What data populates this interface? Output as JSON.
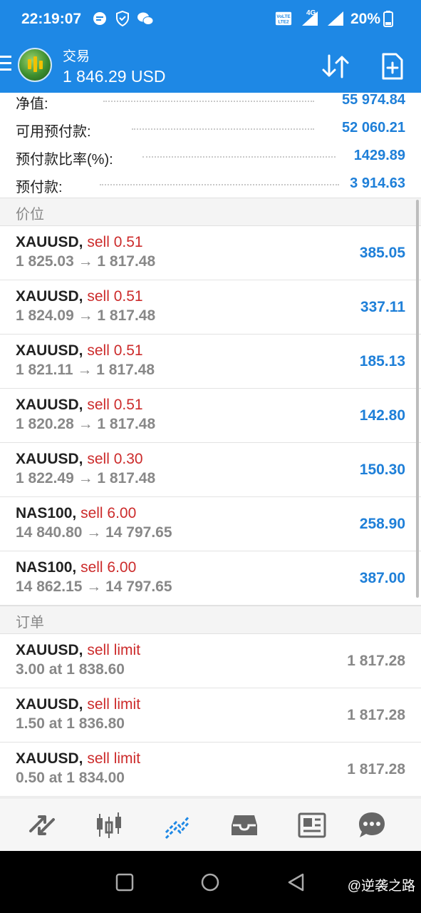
{
  "status_bar": {
    "time": "22:19:07",
    "network_label": "4G",
    "battery": "20%",
    "icons": [
      "chat-bubble-icon",
      "shield-icon",
      "wechat-icon",
      "volte-icon",
      "signal-icon",
      "battery-icon"
    ]
  },
  "toolbar": {
    "title": "交易",
    "balance": "1 846.29 USD",
    "icons": [
      "menu-icon",
      "sort-icon",
      "new-order-icon"
    ]
  },
  "summary": [
    {
      "label": "净值:",
      "value": "55 974.84"
    },
    {
      "label": "可用预付款:",
      "value": "52 060.21"
    },
    {
      "label": "预付款比率(%):",
      "value": "1429.89"
    },
    {
      "label": "预付款:",
      "value": "3 914.63"
    }
  ],
  "sections": {
    "positions_title": "价位",
    "orders_title": "订单"
  },
  "positions": [
    {
      "symbol": "XAUUSD,",
      "side": "sell 0.51",
      "prices": "1 825.03 → 1 817.48",
      "profit": "385.05"
    },
    {
      "symbol": "XAUUSD,",
      "side": "sell 0.51",
      "prices": "1 824.09 → 1 817.48",
      "profit": "337.11"
    },
    {
      "symbol": "XAUUSD,",
      "side": "sell 0.51",
      "prices": "1 821.11 → 1 817.48",
      "profit": "185.13"
    },
    {
      "symbol": "XAUUSD,",
      "side": "sell 0.51",
      "prices": "1 820.28 → 1 817.48",
      "profit": "142.80"
    },
    {
      "symbol": "XAUUSD,",
      "side": "sell 0.30",
      "prices": "1 822.49 → 1 817.48",
      "profit": "150.30"
    },
    {
      "symbol": "NAS100,",
      "side": "sell 6.00",
      "prices": "14 840.80 → 14 797.65",
      "profit": "258.90"
    },
    {
      "symbol": "NAS100,",
      "side": "sell 6.00",
      "prices": "14 862.15 → 14 797.65",
      "profit": "387.00"
    }
  ],
  "orders": [
    {
      "symbol": "XAUUSD,",
      "side": "sell limit",
      "detail": "3.00 at 1 838.60",
      "price": "1 817.28"
    },
    {
      "symbol": "XAUUSD,",
      "side": "sell limit",
      "detail": "1.50 at 1 836.80",
      "price": "1 817.28"
    },
    {
      "symbol": "XAUUSD,",
      "side": "sell limit",
      "detail": "0.50 at 1 834.00",
      "price": "1 817.28"
    }
  ],
  "bottom_nav": [
    "quotes-icon",
    "chart-icon",
    "trade-icon",
    "history-icon",
    "news-icon",
    "messages-icon"
  ],
  "system_nav": [
    "recents-icon",
    "home-icon",
    "back-icon"
  ],
  "watermark": "@逆袭之路",
  "colors": {
    "primary": "#1e88e5",
    "profit_blue": "#1e7fd8",
    "sell_red": "#cc2b2b",
    "muted_grey": "#888888"
  }
}
